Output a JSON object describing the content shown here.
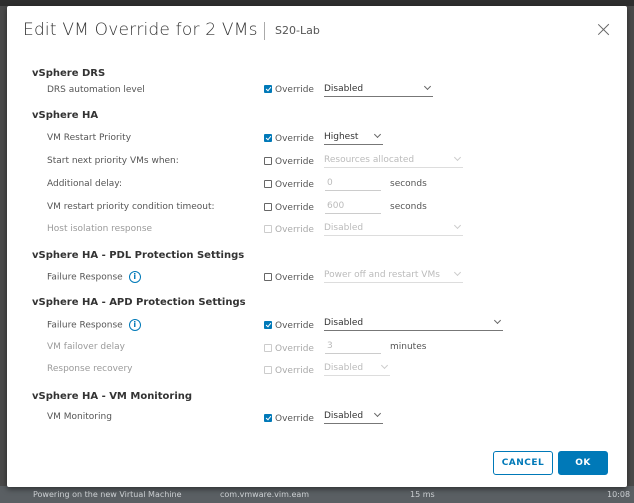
{
  "background": {
    "footer_task": "Powering on the new Virtual Machine",
    "footer_target": "com.vmware.vim.eam",
    "footer_time": "15 ms",
    "footer_right": "10:08"
  },
  "dialog": {
    "title": "Edit VM Override for 2 VMs",
    "subtitle": "S20-Lab",
    "override_label": "Override",
    "cancel_label": "CANCEL",
    "ok_label": "OK"
  },
  "sections": {
    "drs": "vSphere DRS",
    "ha": "vSphere HA",
    "pdl": "vSphere HA - PDL Protection Settings",
    "apd": "vSphere HA - APD Protection Settings",
    "vmmon": "vSphere HA - VM Monitoring"
  },
  "rows": {
    "drs_level": {
      "label": "DRS automation level",
      "value": "Disabled",
      "checked": true
    },
    "restart_priority": {
      "label": "VM Restart Priority",
      "value": "Highest",
      "checked": true
    },
    "start_next": {
      "label": "Start next priority VMs when:",
      "value": "Resources allocated",
      "checked": false
    },
    "additional_delay": {
      "label": "Additional delay:",
      "value": "0",
      "unit": "seconds",
      "checked": false
    },
    "restart_timeout": {
      "label": "VM restart priority condition timeout:",
      "value": "600",
      "unit": "seconds",
      "checked": false
    },
    "host_isolation": {
      "label": "Host isolation response",
      "value": "Disabled",
      "checked": false
    },
    "pdl_failure": {
      "label": "Failure Response",
      "value": "Power off and restart VMs",
      "checked": false
    },
    "apd_failure": {
      "label": "Failure Response",
      "value": "Disabled",
      "checked": true
    },
    "vm_failover_delay": {
      "label": "VM failover delay",
      "value": "3",
      "unit": "minutes",
      "checked": false
    },
    "response_recovery": {
      "label": "Response recovery",
      "value": "Disabled",
      "checked": false
    },
    "vm_monitoring": {
      "label": "VM Monitoring",
      "value": "Disabled",
      "checked": true
    }
  },
  "colors": {
    "accent": "#0079b8"
  },
  "icons": {
    "info": "info-icon",
    "close": "close-icon",
    "dropdown": "chevron-down-icon"
  }
}
